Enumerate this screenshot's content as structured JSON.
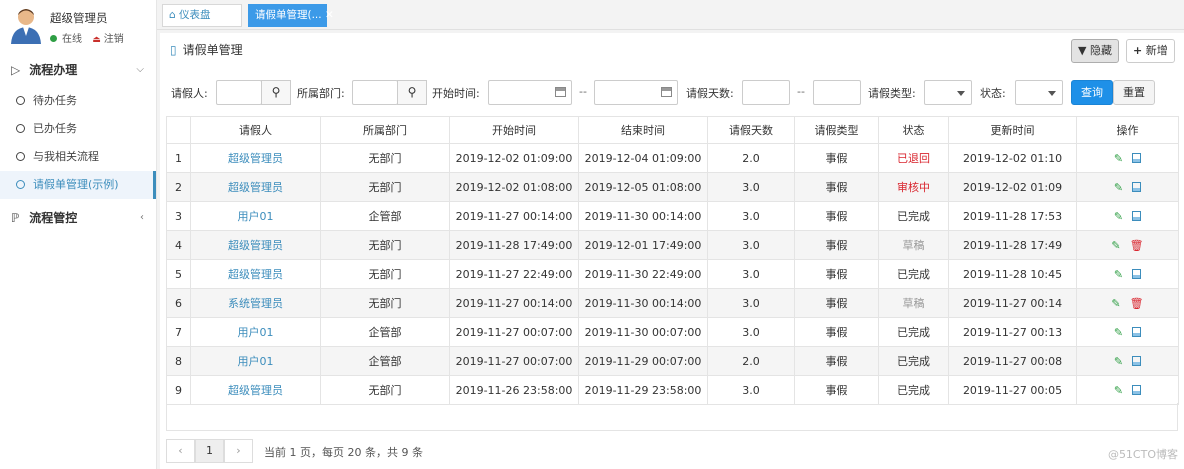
{
  "user": {
    "name": "超级管理员",
    "status": "在线",
    "logout": "注销"
  },
  "sidebar": {
    "group1": {
      "label": "流程办理",
      "expanded": true
    },
    "items": [
      {
        "label": "待办任务"
      },
      {
        "label": "已办任务"
      },
      {
        "label": "与我相关流程"
      },
      {
        "label": "请假单管理(示例)",
        "active": true
      }
    ],
    "group2": {
      "label": "流程管控",
      "expanded": false
    }
  },
  "tabs": [
    {
      "label": "仪表盘"
    },
    {
      "label": "请假单管理(...",
      "active": true
    }
  ],
  "page": {
    "title": "请假单管理"
  },
  "toolbar": {
    "hide": "隐藏",
    "add": "新增"
  },
  "filters": {
    "applicant": "请假人:",
    "dept": "所属部门:",
    "start": "开始时间:",
    "range_sep": "--",
    "days": "请假天数:",
    "type": "请假类型:",
    "status": "状态:",
    "query": "查询",
    "reset": "重置"
  },
  "table": {
    "columns": [
      "",
      "请假人",
      "所属部门",
      "开始时间",
      "结束时间",
      "请假天数",
      "请假类型",
      "状态",
      "更新时间",
      "操作"
    ],
    "rows": [
      {
        "no": "1",
        "user": "超级管理员",
        "dept": "无部门",
        "start": "2019-12-02 01:09:00",
        "end": "2019-12-04 01:09:00",
        "days": "2.0",
        "type": "事假",
        "status": "已退回",
        "status_kind": "back",
        "updated": "2019-12-02 01:10",
        "op": "view"
      },
      {
        "no": "2",
        "user": "超级管理员",
        "dept": "无部门",
        "start": "2019-12-02 01:08:00",
        "end": "2019-12-05 01:08:00",
        "days": "3.0",
        "type": "事假",
        "status": "审核中",
        "status_kind": "review",
        "updated": "2019-12-02 01:09",
        "op": "view"
      },
      {
        "no": "3",
        "user": "用户01",
        "dept": "企管部",
        "start": "2019-11-27 00:14:00",
        "end": "2019-11-30 00:14:00",
        "days": "3.0",
        "type": "事假",
        "status": "已完成",
        "status_kind": "done",
        "updated": "2019-11-28 17:53",
        "op": "view"
      },
      {
        "no": "4",
        "user": "超级管理员",
        "dept": "无部门",
        "start": "2019-11-28 17:49:00",
        "end": "2019-12-01 17:49:00",
        "days": "3.0",
        "type": "事假",
        "status": "草稿",
        "status_kind": "draft",
        "updated": "2019-11-28 17:49",
        "op": "delete"
      },
      {
        "no": "5",
        "user": "超级管理员",
        "dept": "无部门",
        "start": "2019-11-27 22:49:00",
        "end": "2019-11-30 22:49:00",
        "days": "3.0",
        "type": "事假",
        "status": "已完成",
        "status_kind": "done",
        "updated": "2019-11-28 10:45",
        "op": "view"
      },
      {
        "no": "6",
        "user": "系统管理员",
        "dept": "无部门",
        "start": "2019-11-27 00:14:00",
        "end": "2019-11-30 00:14:00",
        "days": "3.0",
        "type": "事假",
        "status": "草稿",
        "status_kind": "draft",
        "updated": "2019-11-27 00:14",
        "op": "delete"
      },
      {
        "no": "7",
        "user": "用户01",
        "dept": "企管部",
        "start": "2019-11-27 00:07:00",
        "end": "2019-11-30 00:07:00",
        "days": "3.0",
        "type": "事假",
        "status": "已完成",
        "status_kind": "done",
        "updated": "2019-11-27 00:13",
        "op": "view"
      },
      {
        "no": "8",
        "user": "用户01",
        "dept": "企管部",
        "start": "2019-11-27 00:07:00",
        "end": "2019-11-29 00:07:00",
        "days": "2.0",
        "type": "事假",
        "status": "已完成",
        "status_kind": "done",
        "updated": "2019-11-27 00:08",
        "op": "view"
      },
      {
        "no": "9",
        "user": "超级管理员",
        "dept": "无部门",
        "start": "2019-11-26 23:58:00",
        "end": "2019-11-29 23:58:00",
        "days": "3.0",
        "type": "事假",
        "status": "已完成",
        "status_kind": "done",
        "updated": "2019-11-27 00:05",
        "op": "view"
      }
    ]
  },
  "pager": {
    "prev": "‹",
    "current": "1",
    "next": "›",
    "info": "当前  1  页，每页  20  条，共 9 条"
  },
  "watermark": "@51CTO博客",
  "colors": {
    "accent": "#3c8dbc",
    "tab_active": "#3c9ae8",
    "query_button": "#1e90e8",
    "status_red": "#d9262f",
    "online": "#2e9e44"
  }
}
